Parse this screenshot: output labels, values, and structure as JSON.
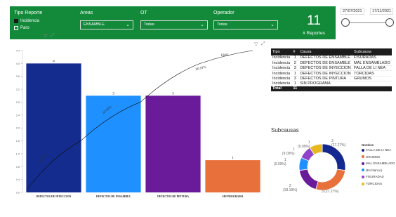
{
  "filters": {
    "tipo_reporte": {
      "title": "Tipo Reporte",
      "options": [
        {
          "label": "Incidencia",
          "selected": true
        },
        {
          "label": "Paro",
          "selected": false
        }
      ]
    },
    "areas": {
      "title": "Areas",
      "value": "ENSAMBLE"
    },
    "ot": {
      "title": "OT",
      "value": "Todas"
    },
    "operador": {
      "title": "Operador",
      "value": "Todas"
    }
  },
  "kpi": {
    "value": "11",
    "label": "# Reportes"
  },
  "date_range": {
    "start": "27/07/2021",
    "end": "17/11/2021"
  },
  "colors": {
    "header_green": "#128a3a",
    "table_header": "#1c1c1c"
  },
  "chart_data": [
    {
      "type": "bar",
      "categories": [
        "DEFECTOS DE INYECCION",
        "DEFECTOS DE ENSAMBLE",
        "DEFECTOS DE PINTURA",
        "SIN PROGRAMA"
      ],
      "values": [
        4,
        3,
        3,
        1
      ],
      "colors": [
        "#142c8e",
        "#1e90ff",
        "#6a1b9a",
        "#e8703a"
      ],
      "pareto_line": {
        "values": [
          36.36,
          63.64,
          90.91,
          100
        ],
        "labels": [
          "36.36%",
          "63.64%",
          "90.91%",
          "100%"
        ]
      },
      "y_ticks": [
        "0.0",
        "0.4",
        "0.8",
        "1.2",
        "1.6",
        "2.0",
        "2.4",
        "2.8",
        "3.2",
        "3.6",
        "4.0",
        "4.4"
      ],
      "ylim": [
        0,
        4.4
      ]
    },
    {
      "type": "pie",
      "title": "Subcausas",
      "legend_title": "Nombre",
      "slices": [
        {
          "name": "FALLA DE LI NEA",
          "value": 3,
          "label": "3\n(27.27%)",
          "color": "#14288f"
        },
        {
          "name": "GRUMOS",
          "value": 3,
          "label": "3 (27.27%)",
          "color": "#e8703a"
        },
        {
          "name": "MAL ENSAMBLADO",
          "value": 2,
          "label": "2\n(18.18%)",
          "color": "#6a1b9a"
        },
        {
          "name": "(En blanco)",
          "value": 1,
          "label": "1\n(9.09%)",
          "color": "#1e90ff"
        },
        {
          "name": "FISURADAS",
          "value": 1,
          "label": "1\n(9.09%)",
          "color": "#8e44c9"
        },
        {
          "name": "TORCIDAS",
          "value": 1,
          "label": "1\n(9.09%)",
          "color": "#e8b820"
        }
      ]
    }
  ],
  "table": {
    "headers": [
      "Tipo",
      "#",
      "Causa",
      "Subcausa"
    ],
    "rows": [
      [
        "Incidencia",
        "1",
        "DEFECTOS DE ENSAMBLE",
        "FISURADAS"
      ],
      [
        "Incidencia",
        "2",
        "DEFECTOS DE ENSAMBLE",
        "MAL ENSAMBLADO"
      ],
      [
        "Incidencia",
        "3",
        "DEFECTOS DE INYECCION",
        "FALLA DE LI   NEA"
      ],
      [
        "Incidencia",
        "1",
        "DEFECTOS DE INYECCION",
        "TORCIDAS"
      ],
      [
        "Incidencia",
        "3",
        "DEFECTOS DE PINTURA",
        "GRUMOS"
      ],
      [
        "Incidencia",
        "1",
        "SIN PROGRAMA",
        ""
      ]
    ],
    "total": [
      "Total",
      "11",
      "",
      ""
    ]
  }
}
